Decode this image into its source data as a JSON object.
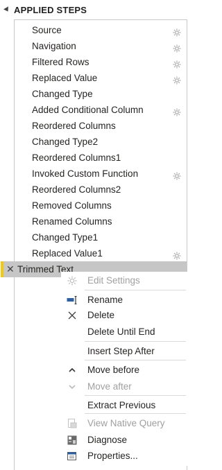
{
  "header": {
    "title": "APPLIED STEPS"
  },
  "steps": [
    {
      "label": "Source",
      "has_gear": true
    },
    {
      "label": "Navigation",
      "has_gear": true
    },
    {
      "label": "Filtered Rows",
      "has_gear": true
    },
    {
      "label": "Replaced Value",
      "has_gear": true
    },
    {
      "label": "Changed Type",
      "has_gear": false
    },
    {
      "label": "Added Conditional Column",
      "has_gear": true
    },
    {
      "label": "Reordered Columns",
      "has_gear": false
    },
    {
      "label": "Changed Type2",
      "has_gear": false
    },
    {
      "label": "Reordered Columns1",
      "has_gear": false
    },
    {
      "label": "Invoked Custom Function",
      "has_gear": true
    },
    {
      "label": "Reordered Columns2",
      "has_gear": false
    },
    {
      "label": "Removed Columns",
      "has_gear": false
    },
    {
      "label": "Renamed Columns",
      "has_gear": false
    },
    {
      "label": "Changed Type1",
      "has_gear": false
    },
    {
      "label": "Replaced Value1",
      "has_gear": true
    }
  ],
  "selected_step": {
    "label": "Trimmed Text"
  },
  "context_menu": {
    "items": [
      {
        "label": "Edit Settings",
        "icon": "gear-icon",
        "disabled": true
      },
      {
        "label": "Rename",
        "icon": "rename-icon",
        "disabled": false
      },
      {
        "label": "Delete",
        "icon": "delete-x-icon",
        "disabled": false
      },
      {
        "label": "Delete Until End",
        "icon": "",
        "disabled": false
      },
      {
        "label": "Insert Step After",
        "icon": "",
        "disabled": false
      },
      {
        "label": "Move before",
        "icon": "chevron-up-icon",
        "disabled": false
      },
      {
        "label": "Move after",
        "icon": "chevron-down-icon",
        "disabled": true
      },
      {
        "label": "Extract Previous",
        "icon": "",
        "disabled": false
      },
      {
        "label": "View Native Query",
        "icon": "native-query-icon",
        "disabled": true
      },
      {
        "label": "Diagnose",
        "icon": "diagnose-icon",
        "disabled": false
      },
      {
        "label": "Properties...",
        "icon": "properties-icon",
        "disabled": false
      }
    ]
  },
  "colors": {
    "selection_bg": "#c6c6c6",
    "selection_accent": "#f2c811",
    "text": "#252423",
    "disabled_text": "#a0a0a0"
  }
}
